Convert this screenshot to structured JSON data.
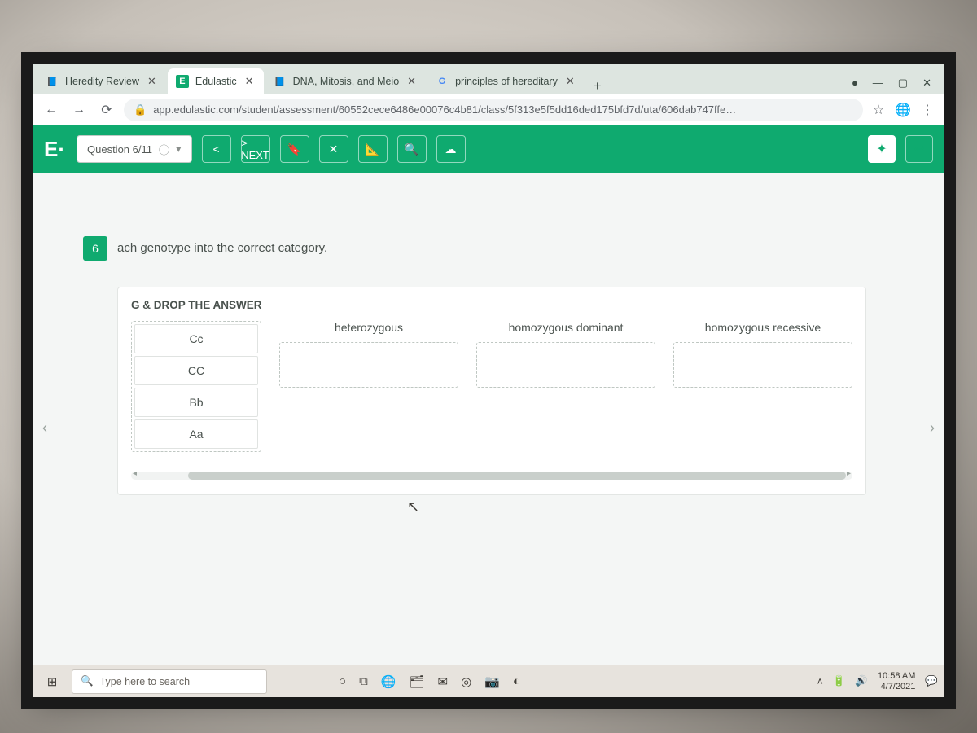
{
  "browser": {
    "tabs": [
      {
        "label": "Heredity Review",
        "active": false,
        "favicon": "📘"
      },
      {
        "label": "Edulastic",
        "active": true,
        "favicon": "E"
      },
      {
        "label": "DNA, Mitosis, and Meio",
        "active": false,
        "favicon": "📘"
      },
      {
        "label": "principles of hereditary",
        "active": false,
        "favicon": "G"
      }
    ],
    "url": "app.edulastic.com/student/assessment/60552cece6486e00076c4b81/class/5f313e5f5dd16ded175bfd7d/uta/606dab747ffe…"
  },
  "header": {
    "logo": "E·",
    "question_label": "Question 6/11",
    "prev": "<",
    "next": "> NEXT"
  },
  "question": {
    "number": "6",
    "text": "ach genotype into the correct category.",
    "panel_title": "G & DROP THE ANSWER",
    "source_items": [
      "Cc",
      "CC",
      "Bb",
      "Aa"
    ],
    "drop_labels": [
      "heterozygous",
      "homozygous dominant",
      "homozygous recessive"
    ]
  },
  "taskbar": {
    "search_placeholder": "Type here to search",
    "time": "10:58 AM",
    "date": "4/7/2021"
  }
}
